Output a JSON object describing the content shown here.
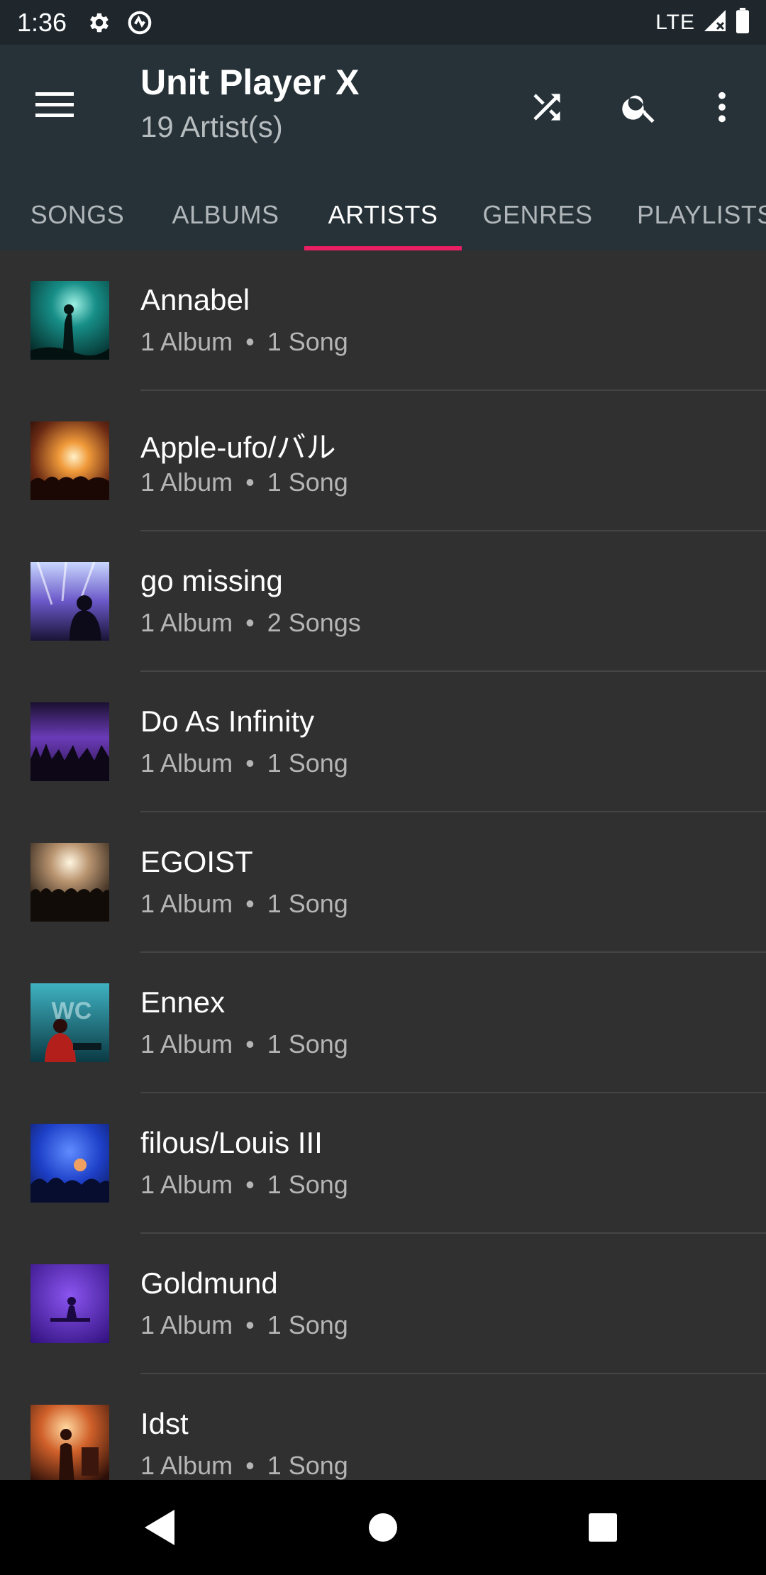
{
  "status_bar": {
    "time": "1:36",
    "network": "LTE",
    "icons": [
      "gear-icon",
      "sync-icon",
      "signal-icon",
      "battery-icon"
    ]
  },
  "app_bar": {
    "title": "Unit Player X",
    "subtitle": "19 Artist(s)",
    "actions": [
      "shuffle-icon",
      "search-icon",
      "more-vert-icon"
    ]
  },
  "tabs": [
    {
      "label": "SONGS",
      "active": false
    },
    {
      "label": "ALBUMS",
      "active": false
    },
    {
      "label": "ARTISTS",
      "active": true
    },
    {
      "label": "GENRES",
      "active": false
    },
    {
      "label": "PLAYLISTS",
      "active": false
    }
  ],
  "artists": [
    {
      "name": "Annabel",
      "albums": "1 Album",
      "songs": "1 Song"
    },
    {
      "name": "Apple-ufo/バル",
      "albums": "1 Album",
      "songs": "1 Song"
    },
    {
      "name": "go missing",
      "albums": "1 Album",
      "songs": "2 Songs"
    },
    {
      "name": "Do As Infinity",
      "albums": "1 Album",
      "songs": "1 Song"
    },
    {
      "name": "EGOIST",
      "albums": "1 Album",
      "songs": "1 Song"
    },
    {
      "name": "Ennex",
      "albums": "1 Album",
      "songs": "1 Song"
    },
    {
      "name": "filous/Louis III",
      "albums": "1 Album",
      "songs": "1 Song"
    },
    {
      "name": "Goldmund",
      "albums": "1 Album",
      "songs": "1 Song"
    },
    {
      "name": "Idst",
      "albums": "1 Album",
      "songs": "1 Song"
    }
  ],
  "meta_separator": "•",
  "colors": {
    "status_bar": "#1f272d",
    "app_bar": "#263238",
    "background": "#303030",
    "accent": "#e91e63"
  },
  "nav_bar": [
    "back-icon",
    "home-icon",
    "recents-icon"
  ]
}
